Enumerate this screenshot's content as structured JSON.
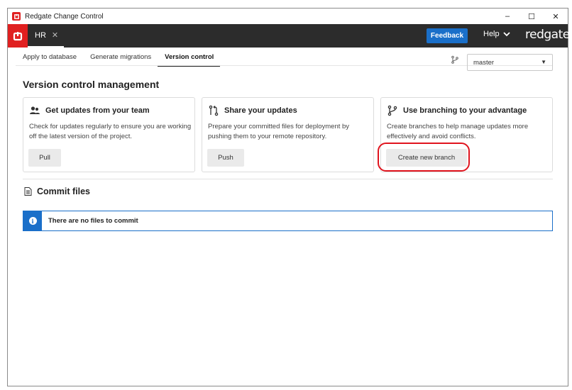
{
  "window": {
    "title": "Redgate Change Control",
    "controls": {
      "minimize": "–",
      "maximize": "☐",
      "close": "✕"
    }
  },
  "appbar": {
    "project_tab": "HR",
    "project_close": "✕",
    "feedback_label": "Feedback",
    "help_label": "Help",
    "brand": "redgate",
    "accent": "#e02020",
    "header_bg": "#2c2c2c",
    "feedback_color": "#1a6fc9"
  },
  "tabs": [
    {
      "label": "Apply to database"
    },
    {
      "label": "Generate migrations"
    },
    {
      "label": "Version control",
      "active": true
    }
  ],
  "branch": {
    "selected": "master",
    "icon": "branch-icon"
  },
  "section_title": "Version control management",
  "cards": [
    {
      "title": "Get updates from your team",
      "icon": "team-icon",
      "description": "Check for updates regularly to ensure you are working off the latest version of the project.",
      "button": "Pull"
    },
    {
      "title": "Share your updates",
      "icon": "push-icon",
      "description": "Prepare your committed files for deployment by pushing them to your remote repository.",
      "button": "Push"
    },
    {
      "title": "Use branching to your advantage",
      "icon": "branching-icon",
      "description": "Create branches to help manage updates more effectively and avoid conflicts.",
      "button": "Create new branch"
    }
  ],
  "commit": {
    "title": "Commit files",
    "info_message": "There are no files to commit",
    "info_color": "#1a6fc9"
  }
}
